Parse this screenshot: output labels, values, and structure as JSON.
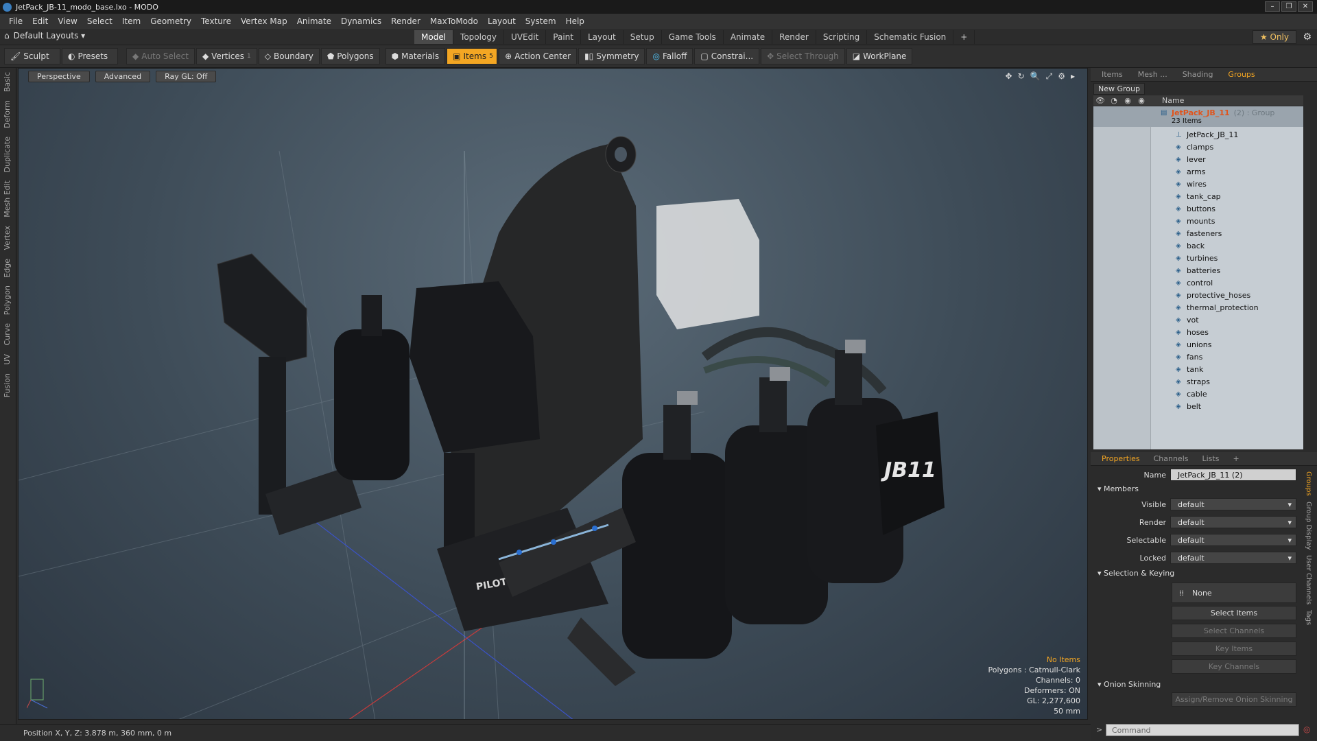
{
  "window": {
    "title": "JetPack_JB-11_modo_base.lxo - MODO",
    "buttons": [
      "–",
      "❐",
      "✕"
    ]
  },
  "menu": [
    "File",
    "Edit",
    "View",
    "Select",
    "Item",
    "Geometry",
    "Texture",
    "Vertex Map",
    "Animate",
    "Dynamics",
    "Render",
    "MaxToModo",
    "Layout",
    "System",
    "Help"
  ],
  "modebar": {
    "layouts_label": "Default Layouts ▾",
    "tabs": [
      "Model",
      "Topology",
      "UVEdit",
      "Paint",
      "Layout",
      "Setup",
      "Game Tools",
      "Animate",
      "Render",
      "Scripting",
      "Schematic Fusion"
    ],
    "active_tab": "Model",
    "plus": "+",
    "only_label": "★  Only"
  },
  "toolbar": {
    "sculpt": "Sculpt",
    "presets": "Presets",
    "auto_select": "Auto Select",
    "vertices": "Vertices",
    "vertices_count": "1",
    "boundary": "Boundary",
    "polygons": "Polygons",
    "materials": "Materials",
    "items": "Items",
    "items_count": "5",
    "action_center": "Action Center",
    "symmetry": "Symmetry",
    "falloff": "Falloff",
    "constraints": "Constrai...",
    "select_through": "Select Through",
    "workplane": "WorkPlane"
  },
  "left_tabs": [
    "Basic",
    "Deform",
    "Duplicate",
    "Mesh Edit",
    "Vertex",
    "Edge",
    "Polygon",
    "Curve",
    "UV",
    "Fusion"
  ],
  "viewport": {
    "view": "Perspective",
    "shading": "Advanced",
    "raygl": "Ray GL: Off",
    "info": {
      "status": "No Items",
      "polygons": "Polygons : Catmull-Clark",
      "channels": "Channels: 0",
      "deformers": "Deformers: ON",
      "gl": "GL: 2,277,600",
      "scale": "50 mm"
    },
    "model_labels": {
      "pilot": "PILOT",
      "jb": "JB11"
    }
  },
  "statusbar": {
    "position": "Position X, Y, Z:   3.878 m, 360 mm, 0 m"
  },
  "right_panel": {
    "tabs": [
      "Items",
      "Mesh ...",
      "Shading",
      "Groups"
    ],
    "active_tab": "Groups",
    "new_group": "New Group",
    "col_name": "Name",
    "group": {
      "name": "JetPack_JB_11",
      "suffix": "(2) : Group",
      "count": "23 Items"
    },
    "members": [
      "JetPack_JB_11",
      "clamps",
      "lever",
      "arms",
      "wires",
      "tank_cap",
      "buttons",
      "mounts",
      "fasteners",
      "back",
      "turbines",
      "batteries",
      "control",
      "protective_hoses",
      "thermal_protection",
      "vot",
      "hoses",
      "unions",
      "fans",
      "tank",
      "straps",
      "cable",
      "belt"
    ]
  },
  "properties": {
    "tabs": [
      "Properties",
      "Channels",
      "Lists",
      "+"
    ],
    "active_tab": "Properties",
    "name_label": "Name",
    "name_value": "JetPack_JB_11 (2)",
    "members_section": "Members",
    "visible_label": "Visible",
    "visible_value": "default",
    "render_label": "Render",
    "render_value": "default",
    "selectable_label": "Selectable",
    "selectable_value": "default",
    "locked_label": "Locked",
    "locked_value": "default",
    "selection_section": "Selection & Keying",
    "none_btn": "None",
    "select_items": "Select Items",
    "select_channels": "Select Channels",
    "key_items": "Key Items",
    "key_channels": "Key Channels",
    "onion_section": "Onion Skinning",
    "onion_btn": "Assign/Remove Onion Skinning",
    "side_tabs": [
      "Groups",
      "Group Display",
      "User Channels",
      "Tags"
    ],
    "command_placeholder": "Command"
  }
}
